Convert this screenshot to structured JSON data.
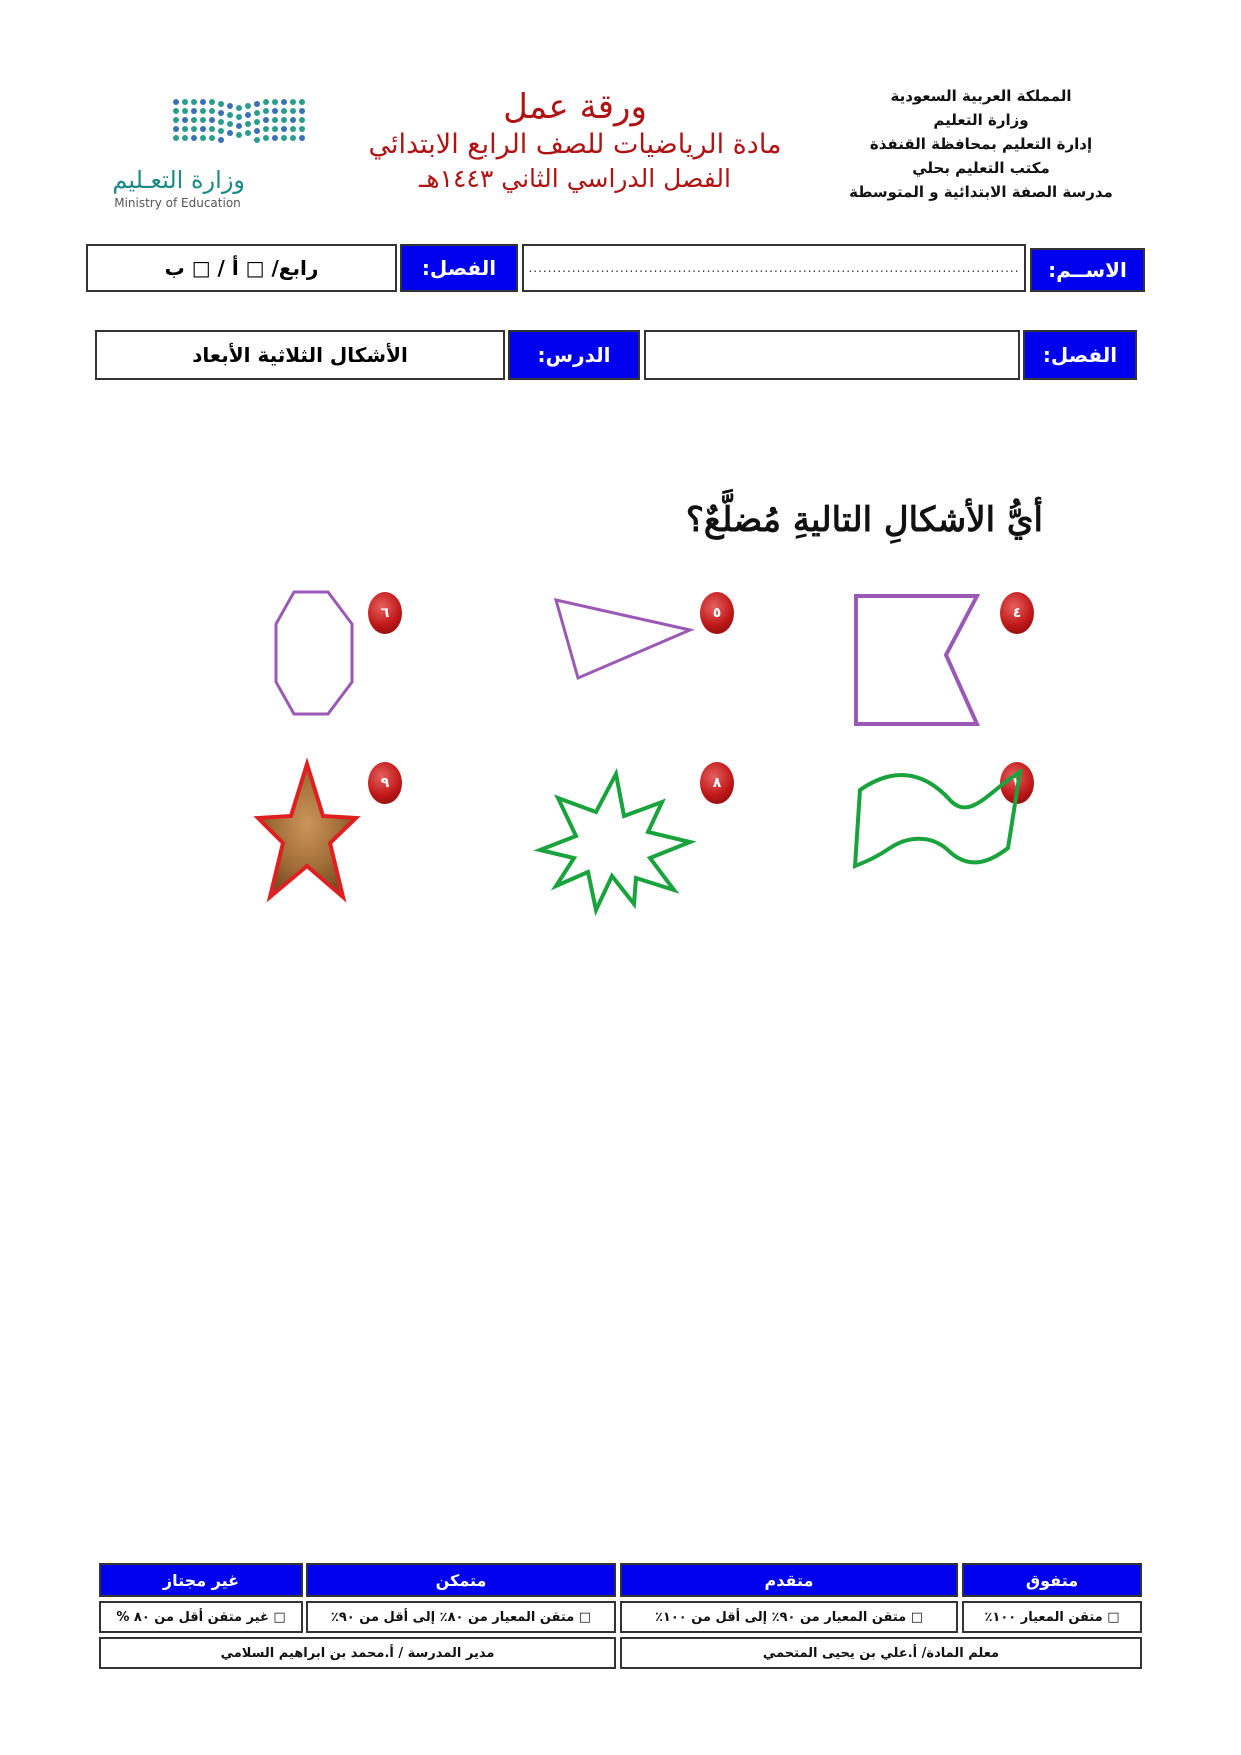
{
  "header": {
    "right_lines": [
      "المملكة العربية السعودية",
      "وزارة التعليم",
      "إدارة التعليم بمحافظة القنفذة",
      "مكتب التعليم بحلي",
      "مدرسة الصفة الابتدائية و المتوسطة"
    ],
    "title": "ورقة عمل",
    "subtitle": "مادة الرياضيات للصف الرابع الابتدائي",
    "term": "الفصل الدراسي الثاني ١٤٤٣هـ",
    "logo_arabic": "وزارة التعـليم",
    "logo_english": "Ministry of Education"
  },
  "row1": {
    "name_label": "الاســم:",
    "name_dots": "......................................................................................................",
    "class_label": "الفصل:",
    "class_value": "رابع/ □ أ  /  □ ب"
  },
  "row2": {
    "chapter_label": "الفصل:",
    "chapter_value": "",
    "lesson_label": "الدرس:",
    "lesson_value": "الأشكال الثلاثية الأبعاد"
  },
  "question": "أيُّ الأشكالِ التاليةِ مُضلَّعٌ؟",
  "items": [
    {
      "num": "٤",
      "shape": "flag-polygon"
    },
    {
      "num": "٥",
      "shape": "triangle"
    },
    {
      "num": "٦",
      "shape": "octagon"
    },
    {
      "num": "٧",
      "shape": "wavy-flag"
    },
    {
      "num": "٨",
      "shape": "burst"
    },
    {
      "num": "٩",
      "shape": "star"
    }
  ],
  "colors": {
    "title_red": "#b01313",
    "header_blue": "#0000ee",
    "purple": "#9b59b6",
    "green": "#1aa33c",
    "star_red": "#e02020",
    "star_brown": "#b07a3c"
  },
  "footer": {
    "headers": [
      "متفوق",
      "متقدم",
      "متمكن",
      "غير مجتاز"
    ],
    "criteria": [
      "□ متقن المعيار ١٠٠٪",
      "□ متقن المعيار من ٩٠٪  إلى أقل من ١٠٠٪",
      "□ متقن المعيار من ٨٠٪ إلى أقل من ٩٠٪",
      "□ غير متقن أقل من ٨٠ %"
    ],
    "teacher": "معلم المادة/ أ.علي بن يحيى المتحمي",
    "principal": "مدير المدرسة / أ.محمد بن ابراهيم السلامي"
  }
}
